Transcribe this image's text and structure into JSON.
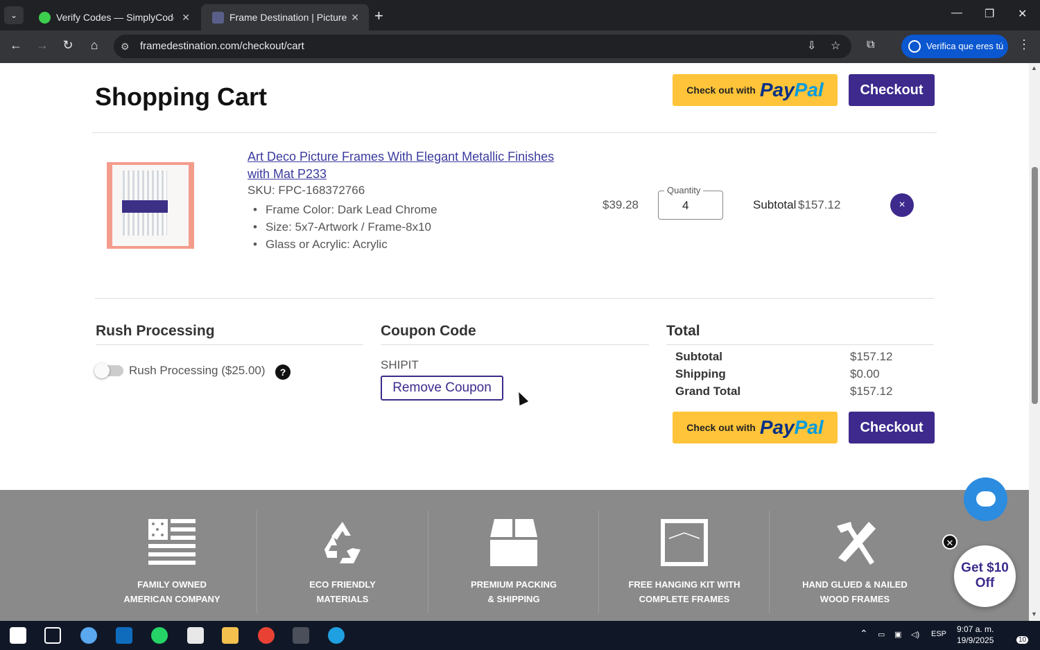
{
  "browser": {
    "tabs": [
      {
        "title": "Verify Codes — SimplyCodes",
        "active": false
      },
      {
        "title": "Frame Destination | Picture Fran",
        "active": true
      }
    ],
    "url": "framedestination.com/checkout/cart",
    "verify_pill": "Verifica que eres tú"
  },
  "page": {
    "title": "Shopping Cart",
    "paypal_prefix": "Check out with",
    "paypal_pay": "Pay",
    "paypal_pal": "Pal",
    "checkout_label": "Checkout"
  },
  "cart_item": {
    "name": "Art Deco Picture Frames With Elegant Metallic Finishes with Mat P233",
    "sku": "SKU: FPC-168372766",
    "attributes": [
      "Frame Color: Dark Lead Chrome",
      "Size: 5x7-Artwork / Frame-8x10",
      "Glass or Acrylic: Acrylic"
    ],
    "price": "$39.28",
    "quantity_label": "Quantity",
    "quantity": "4",
    "subtotal_label": "Subtotal",
    "subtotal": "$157.12",
    "remove_icon": "×"
  },
  "rush": {
    "heading": "Rush Processing",
    "label": "Rush Processing ($25.00)",
    "enabled": false,
    "help_icon": "?"
  },
  "coupon": {
    "heading": "Coupon Code",
    "code": "SHIPIT",
    "remove_label": "Remove Coupon"
  },
  "totals": {
    "heading": "Total",
    "rows": [
      {
        "label": "Subtotal",
        "value": "$157.12"
      },
      {
        "label": "Shipping",
        "value": "$0.00"
      },
      {
        "label": "Grand Total",
        "value": "$157.12"
      }
    ]
  },
  "features": [
    {
      "line1": "FAMILY OWNED",
      "line2": "AMERICAN COMPANY",
      "icon": "flag-icon"
    },
    {
      "line1": "ECO FRIENDLY",
      "line2": "MATERIALS",
      "icon": "recycle-icon"
    },
    {
      "line1": "PREMIUM PACKING",
      "line2": "& SHIPPING",
      "icon": "box-icon"
    },
    {
      "line1": "FREE HANGING KIT WITH",
      "line2": "COMPLETE FRAMES",
      "icon": "frame-icon"
    },
    {
      "line1": "HAND GLUED & NAILED",
      "line2": "WOOD FRAMES",
      "icon": "tools-icon"
    }
  ],
  "promo": {
    "text": "Get $10 Off"
  },
  "taskbar": {
    "lang": "ESP",
    "time": "9:07 a. m.",
    "date": "19/9/2025",
    "notifications": "10"
  },
  "colors": {
    "brand_purple": "#3d2a8c",
    "paypal_yellow": "#ffc439",
    "footer_gray": "#8a8a8a"
  }
}
